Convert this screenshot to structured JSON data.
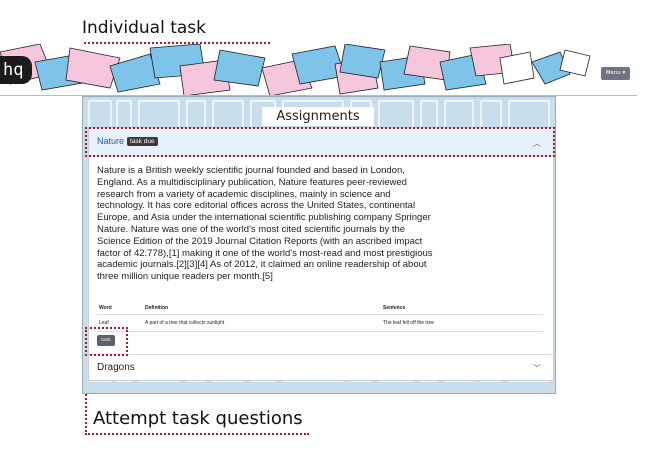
{
  "annotations": {
    "top": "Individual task",
    "bottom": "Attempt task questions"
  },
  "navbar": {
    "logo": "hq",
    "menu_label": "Menu ▾"
  },
  "board": {
    "title": "Assignments"
  },
  "accordion": [
    {
      "title": "Nature",
      "badge": "task due",
      "expanded": true,
      "description": "Nature is a British weekly scientific journal founded and based in London, England. As a multidisciplinary publication, Nature features peer-reviewed research from a variety of academic disciplines, mainly in science and technology. It has core editorial offices across the United States, continental Europe, and Asia under the international scientific publishing company Springer Nature. Nature was one of the world's most cited scientific journals by the Science Edition of the 2019 Journal Citation Reports (with an ascribed impact factor of 42.778),[1] making it one of the world's most-read and most prestigious academic journals.[2][3][4] As of 2012, it claimed an online readership of about three million unique readers per month.[5]",
      "table": {
        "headers": [
          "Word",
          "Definition",
          "Sentence"
        ],
        "rows": [
          [
            "Leaf",
            "A part of a tree that collects sunlight",
            "The leaf fell off the tree"
          ]
        ]
      },
      "task_button": "task"
    },
    {
      "title": "Dragons",
      "expanded": false
    }
  ],
  "colors": {
    "accent_blue": "#1a5fb4",
    "annotation_red": "#a01c2c",
    "paper_blue": "#7ec3ea",
    "paper_pink": "#f6c6dc"
  },
  "icons": {
    "chevron_up": "chevron-up-icon",
    "chevron_down": "chevron-down-icon"
  }
}
